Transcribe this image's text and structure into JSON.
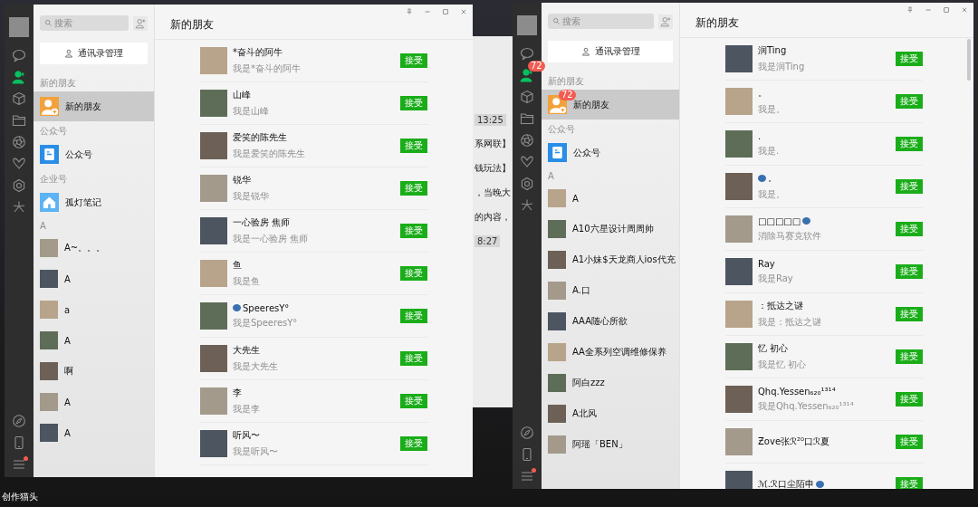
{
  "desktop": {
    "caption": "创作猫头"
  },
  "background_window": {
    "lines": [
      {
        "text": "13:25",
        "kind": "time"
      },
      {
        "text": "系网联】",
        "kind": "text"
      },
      {
        "text": "钱玩法】",
        "kind": "text"
      },
      {
        "text": "，当晚大",
        "kind": "text"
      },
      {
        "text": "的内容，",
        "kind": "text"
      },
      {
        "text": "8:27",
        "kind": "time"
      }
    ]
  },
  "windows": [
    {
      "nav_top": [
        {
          "kind": "chat",
          "selected": false
        },
        {
          "kind": "contacts",
          "selected": true
        },
        {
          "kind": "cube",
          "selected": false
        },
        {
          "kind": "folder",
          "selected": false
        },
        {
          "kind": "aperture",
          "selected": false
        },
        {
          "kind": "butterfly",
          "selected": false
        },
        {
          "kind": "hexagon",
          "selected": false
        },
        {
          "kind": "sparkle",
          "selected": false
        }
      ],
      "nav_bottom": [
        {
          "kind": "compass"
        },
        {
          "kind": "phone"
        },
        {
          "kind": "menu",
          "dot": true
        }
      ],
      "search": {
        "placeholder": "搜索"
      },
      "manage_button": "通讯录管理",
      "sections": [
        {
          "header": "新的朋友",
          "items": [
            {
              "name": "新的朋友",
              "kind": "new-friend",
              "selected": true
            }
          ]
        },
        {
          "header": "公众号",
          "items": [
            {
              "name": "公众号",
              "kind": "official-account",
              "selected": false
            }
          ]
        },
        {
          "header": "企业号",
          "items": [
            {
              "name": "孤灯笔记",
              "kind": "enterprise",
              "selected": false
            }
          ]
        },
        {
          "header": "A",
          "items": [
            {
              "name": "A~。。。",
              "kind": "photo",
              "selected": false
            },
            {
              "name": "A",
              "kind": "photo",
              "selected": false
            },
            {
              "name": "a",
              "kind": "photo",
              "selected": false
            },
            {
              "name": "A",
              "kind": "photo",
              "selected": false
            },
            {
              "name": "啊",
              "kind": "photo",
              "selected": false
            },
            {
              "name": "A",
              "kind": "photo",
              "selected": false
            },
            {
              "name": "A",
              "kind": "photo",
              "selected": false
            }
          ]
        }
      ],
      "title": "新的朋友",
      "requests": [
        {
          "name": "*奋斗的阿牛",
          "message": "我是*奋斗的阿牛",
          "button": "接受"
        },
        {
          "name": "山峰",
          "message": "我是山峰",
          "button": "接受"
        },
        {
          "name": "爱笑的陈先生",
          "message": "我是爱笑的陈先生",
          "button": "接受"
        },
        {
          "name": "锐华",
          "message": "我是锐华",
          "button": "接受"
        },
        {
          "name": "一心验房 焦师",
          "message": "我是一心验房 焦师",
          "button": "接受"
        },
        {
          "name": "鱼",
          "message": "我是鱼",
          "button": "接受"
        },
        {
          "name": "SpeeresY°",
          "message": "我是SpeeresY°",
          "button": "接受",
          "emoji_before": true
        },
        {
          "name": "大先生",
          "message": "我是大先生",
          "button": "接受"
        },
        {
          "name": "李",
          "message": "我是李",
          "button": "接受"
        },
        {
          "name": "听风〜",
          "message": "我是听风〜",
          "button": "接受"
        }
      ]
    },
    {
      "nav_top": [
        {
          "kind": "chat",
          "selected": false
        },
        {
          "kind": "contacts",
          "selected": true,
          "badge": "72"
        },
        {
          "kind": "cube",
          "selected": false
        },
        {
          "kind": "folder",
          "selected": false
        },
        {
          "kind": "aperture",
          "selected": false
        },
        {
          "kind": "butterfly",
          "selected": false
        },
        {
          "kind": "hexagon",
          "selected": false
        },
        {
          "kind": "sparkle",
          "selected": false
        }
      ],
      "nav_bottom": [
        {
          "kind": "compass"
        },
        {
          "kind": "phone"
        },
        {
          "kind": "menu",
          "dot": true
        }
      ],
      "search": {
        "placeholder": "搜索"
      },
      "manage_button": "通讯录管理",
      "sections": [
        {
          "header": "新的朋友",
          "items": [
            {
              "name": "新的朋友",
              "kind": "new-friend",
              "selected": true,
              "badge": "72"
            }
          ]
        },
        {
          "header": "公众号",
          "items": [
            {
              "name": "公众号",
              "kind": "official-account",
              "selected": false
            }
          ]
        },
        {
          "header": "A",
          "items": [
            {
              "name": "A",
              "kind": "photo",
              "selected": false
            },
            {
              "name": "A10六星设计周周帅",
              "kind": "photo",
              "selected": false
            },
            {
              "name": "A1小妹$天龙商人ios代充",
              "kind": "photo",
              "selected": false
            },
            {
              "name": "A.口",
              "kind": "photo",
              "selected": false
            },
            {
              "name": "AAA随心所欲",
              "kind": "photo",
              "selected": false
            },
            {
              "name": "AA全系列空调维修保养",
              "kind": "photo",
              "selected": false
            },
            {
              "name": "阿白zzz",
              "kind": "photo",
              "selected": false
            },
            {
              "name": "A北风",
              "kind": "photo",
              "selected": false
            },
            {
              "name": "阿瑶「BEN」",
              "kind": "photo",
              "selected": false
            }
          ]
        }
      ],
      "title": "新的朋友",
      "requests": [
        {
          "name": "润Ting",
          "message": "我是润Ting",
          "button": "接受"
        },
        {
          "name": "。",
          "message": "我是。",
          "button": "接受"
        },
        {
          "name": ".",
          "message": "我是.",
          "button": "接受"
        },
        {
          "name": "。",
          "message": "我是。",
          "button": "接受",
          "emoji_before": true
        },
        {
          "name": "□□□□□",
          "message": "消除马赛克软件",
          "button": "接受",
          "emoji_after": true
        },
        {
          "name": "Ray",
          "message": "我是Ray",
          "button": "接受"
        },
        {
          "name": "：抵达之谜",
          "message": "我是：抵达之谜",
          "button": "接受"
        },
        {
          "name": "忆 初心",
          "message": "我是忆 初心",
          "button": "接受"
        },
        {
          "name": "Qhq.Yessen₆₂₀¹³¹⁴",
          "message": "我是Qhq.Yessen₆₂₀¹³¹⁴",
          "button": "接受"
        },
        {
          "name": "Ƶove张ℛ²⁰口ℛ夏",
          "button": "接受"
        },
        {
          "name": "ℳ.ℛ口尘陌申",
          "button": "接受",
          "emoji_after": true
        }
      ],
      "scrollbar": true
    }
  ]
}
